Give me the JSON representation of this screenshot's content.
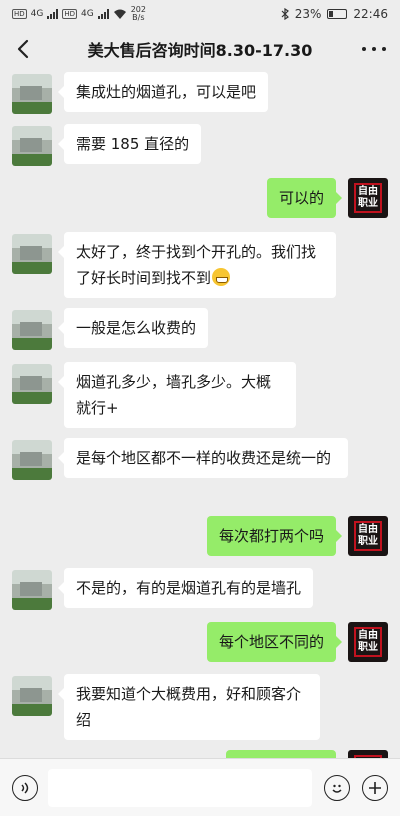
{
  "status_bar": {
    "hd1": "HD",
    "hd2": "HD",
    "net1": "4G",
    "net2": "4G",
    "speed_value": "202",
    "speed_unit": "B/s",
    "battery_percent": "23%",
    "battery_level": 0.23,
    "time": "22:46"
  },
  "header": {
    "title": "美大售后咨询时间8.30-17.30",
    "back_icon": "chevron-left-icon",
    "more_icon": "more-icon"
  },
  "messages": [
    {
      "side": "left",
      "text": "集成灶的烟道孔，可以是吧"
    },
    {
      "side": "left",
      "text": "需要 185 直径的"
    },
    {
      "side": "right",
      "text": "可以的"
    },
    {
      "side": "left",
      "text": "太好了，终于找到个开孔的。我们找了好长时间到找不到",
      "emoji": "grin-emoji"
    },
    {
      "side": "left",
      "text": "一般是怎么收费的"
    },
    {
      "side": "left",
      "text": "烟道孔多少，墙孔多少。大概就行+"
    },
    {
      "side": "left",
      "text": "是每个地区都不一样的收费还是统一的"
    },
    {
      "side": "right",
      "text": "每次都打两个吗"
    },
    {
      "side": "left",
      "text": "不是的，有的是烟道孔有的是墙孔"
    },
    {
      "side": "right",
      "text": "每个地区不同的"
    },
    {
      "side": "left",
      "text": "我要知道个大概费用，好和顾客介绍"
    }
  ],
  "self_avatar": {
    "line1": "自由",
    "line2": "职业"
  },
  "input_bar": {
    "voice_icon": "voice-icon",
    "emoji_icon": "emoji-icon",
    "plus_icon": "plus-icon"
  },
  "colors": {
    "background": "#ededed",
    "bubble_self": "#95ec69",
    "bubble_other": "#ffffff"
  }
}
